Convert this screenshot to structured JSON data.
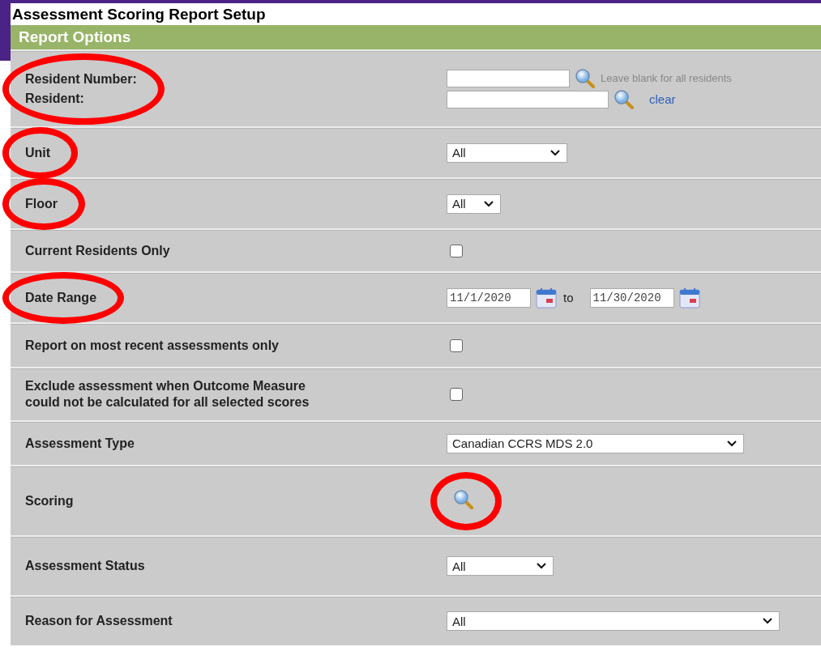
{
  "window": {
    "title": "Assessment Scoring Report Setup"
  },
  "section": {
    "title": "Report Options"
  },
  "rows": [
    {
      "kind": "resident",
      "circled": true,
      "labels": [
        "Resident Number:",
        "Resident:"
      ],
      "hint": "Leave blank for all residents",
      "link": "clear"
    },
    {
      "kind": "select",
      "circled": true,
      "label": "Unit",
      "value": "All"
    },
    {
      "kind": "select",
      "circled": true,
      "label": "Floor",
      "value": "All"
    },
    {
      "kind": "checkbox",
      "circled": false,
      "label": "Current Residents Only",
      "checked": false
    },
    {
      "kind": "date_range",
      "circled": true,
      "label": "Date Range",
      "from": "11/1/2020",
      "separator": "to",
      "to": "11/30/2020"
    },
    {
      "kind": "checkbox",
      "circled": false,
      "label": "Report on most recent assessments only",
      "checked": false
    },
    {
      "kind": "checkbox",
      "circled": false,
      "label": "Exclude assessment when Outcome Measure could not be calculated for all selected scores",
      "checked": false
    },
    {
      "kind": "select",
      "circled": false,
      "label": "Assessment Type",
      "value": "Canadian CCRS MDS 2.0"
    },
    {
      "kind": "lookup",
      "circled": true,
      "label": "Scoring"
    },
    {
      "kind": "select",
      "circled": false,
      "label": "Assessment Status",
      "value": "All"
    },
    {
      "kind": "select",
      "circled": false,
      "label": "Reason for Assessment",
      "value": "All"
    }
  ]
}
